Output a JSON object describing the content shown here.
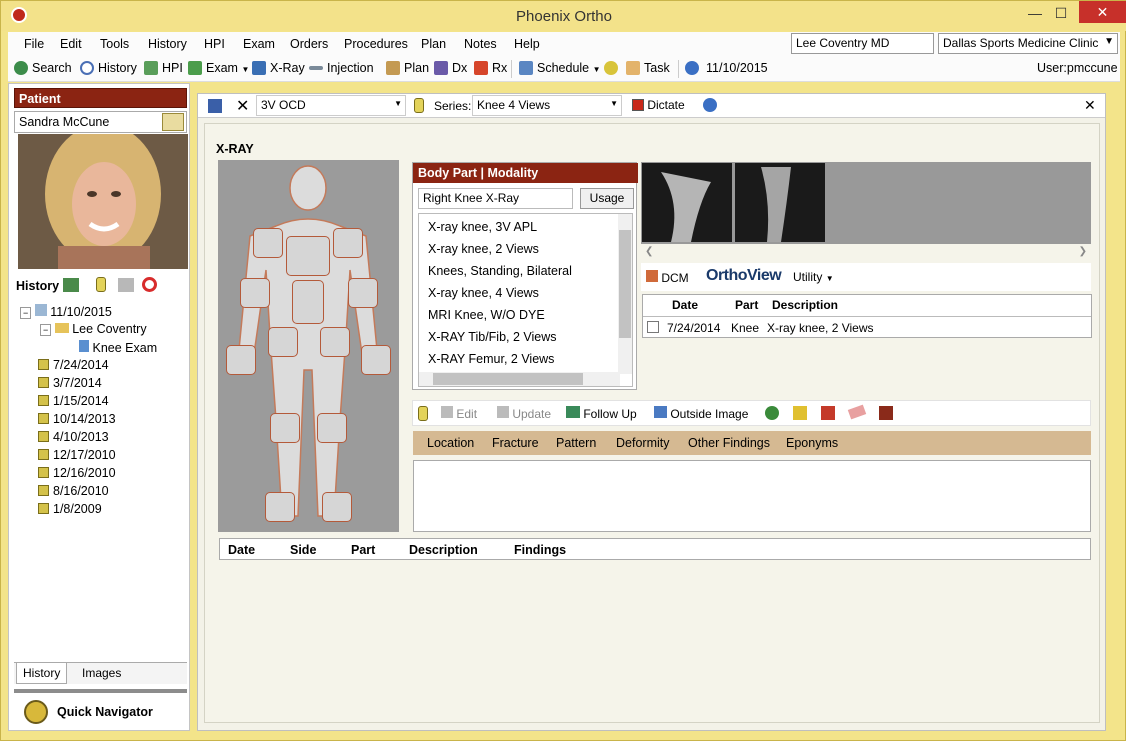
{
  "window": {
    "title": "Phoenix Ortho",
    "min": "—",
    "max": "☐",
    "close": "✕"
  },
  "menu": [
    "File",
    "Edit",
    "Tools",
    "History",
    "HPI",
    "Exam",
    "Orders",
    "Procedures",
    "Plan",
    "Notes",
    "Help"
  ],
  "provider": "Lee Coventry MD",
  "clinic": "Dallas Sports Medicine Clinic",
  "toolbar": {
    "search": "Search",
    "history": "History",
    "hpi": "HPI",
    "exam": "Exam",
    "xray": "X-Ray",
    "injection": "Injection",
    "plan": "Plan",
    "dx": "Dx",
    "rx": "Rx",
    "schedule": "Schedule",
    "task": "Task",
    "date": "11/10/2015",
    "user": "User:pmccune"
  },
  "patient": {
    "header": "Patient",
    "name": "Sandra McCune"
  },
  "history": {
    "header": "History",
    "root": "11/10/2015",
    "provider_node": "Lee Coventry",
    "exam_node": "Knee Exam",
    "dates": [
      "7/24/2014",
      "3/7/2014",
      "1/15/2014",
      "10/14/2013",
      "4/10/2013",
      "12/17/2010",
      "12/16/2010",
      "8/16/2010",
      "1/8/2009"
    ]
  },
  "left_tabs": {
    "history": "History",
    "images": "Images"
  },
  "quick_nav": "Quick Navigator",
  "docbar": {
    "template": "3V OCD",
    "series_label": "Series:",
    "series": "Knee 4 Views",
    "dictate": "Dictate"
  },
  "section_title": "X-RAY",
  "body_part": {
    "header": "Body Part  |  Modality",
    "search": "Right Knee X-Ray",
    "usage": "Usage",
    "items": [
      "X-ray knee, 3V APL",
      "X-ray knee, 2 Views",
      "Knees, Standing, Bilateral",
      "X-ray knee, 4 Views",
      "MRI Knee, W/O DYE",
      "X-RAY Tib/Fib, 2 Views",
      "X-RAY Femur, 2 Views"
    ]
  },
  "dcm": {
    "dcm": "DCM",
    "orthoview": "OrthoView",
    "utility": "Utility"
  },
  "dcm_table": {
    "headers": [
      "Date",
      "Part",
      "Description"
    ],
    "row": [
      "7/24/2014",
      "Knee",
      "X-ray knee, 2 Views"
    ]
  },
  "actions": {
    "edit": "Edit",
    "update": "Update",
    "follow_up": "Follow Up",
    "outside_image": "Outside Image"
  },
  "finding_tabs": [
    "Location",
    "Fracture",
    "Pattern",
    "Deformity",
    "Other Findings",
    "Eponyms"
  ],
  "bottom_table": [
    "Date",
    "Side",
    "Part",
    "Description",
    "Findings"
  ],
  "colors": {
    "accent": "#8b2412",
    "frame": "#f3e48a",
    "tabs": "#d5b992"
  }
}
